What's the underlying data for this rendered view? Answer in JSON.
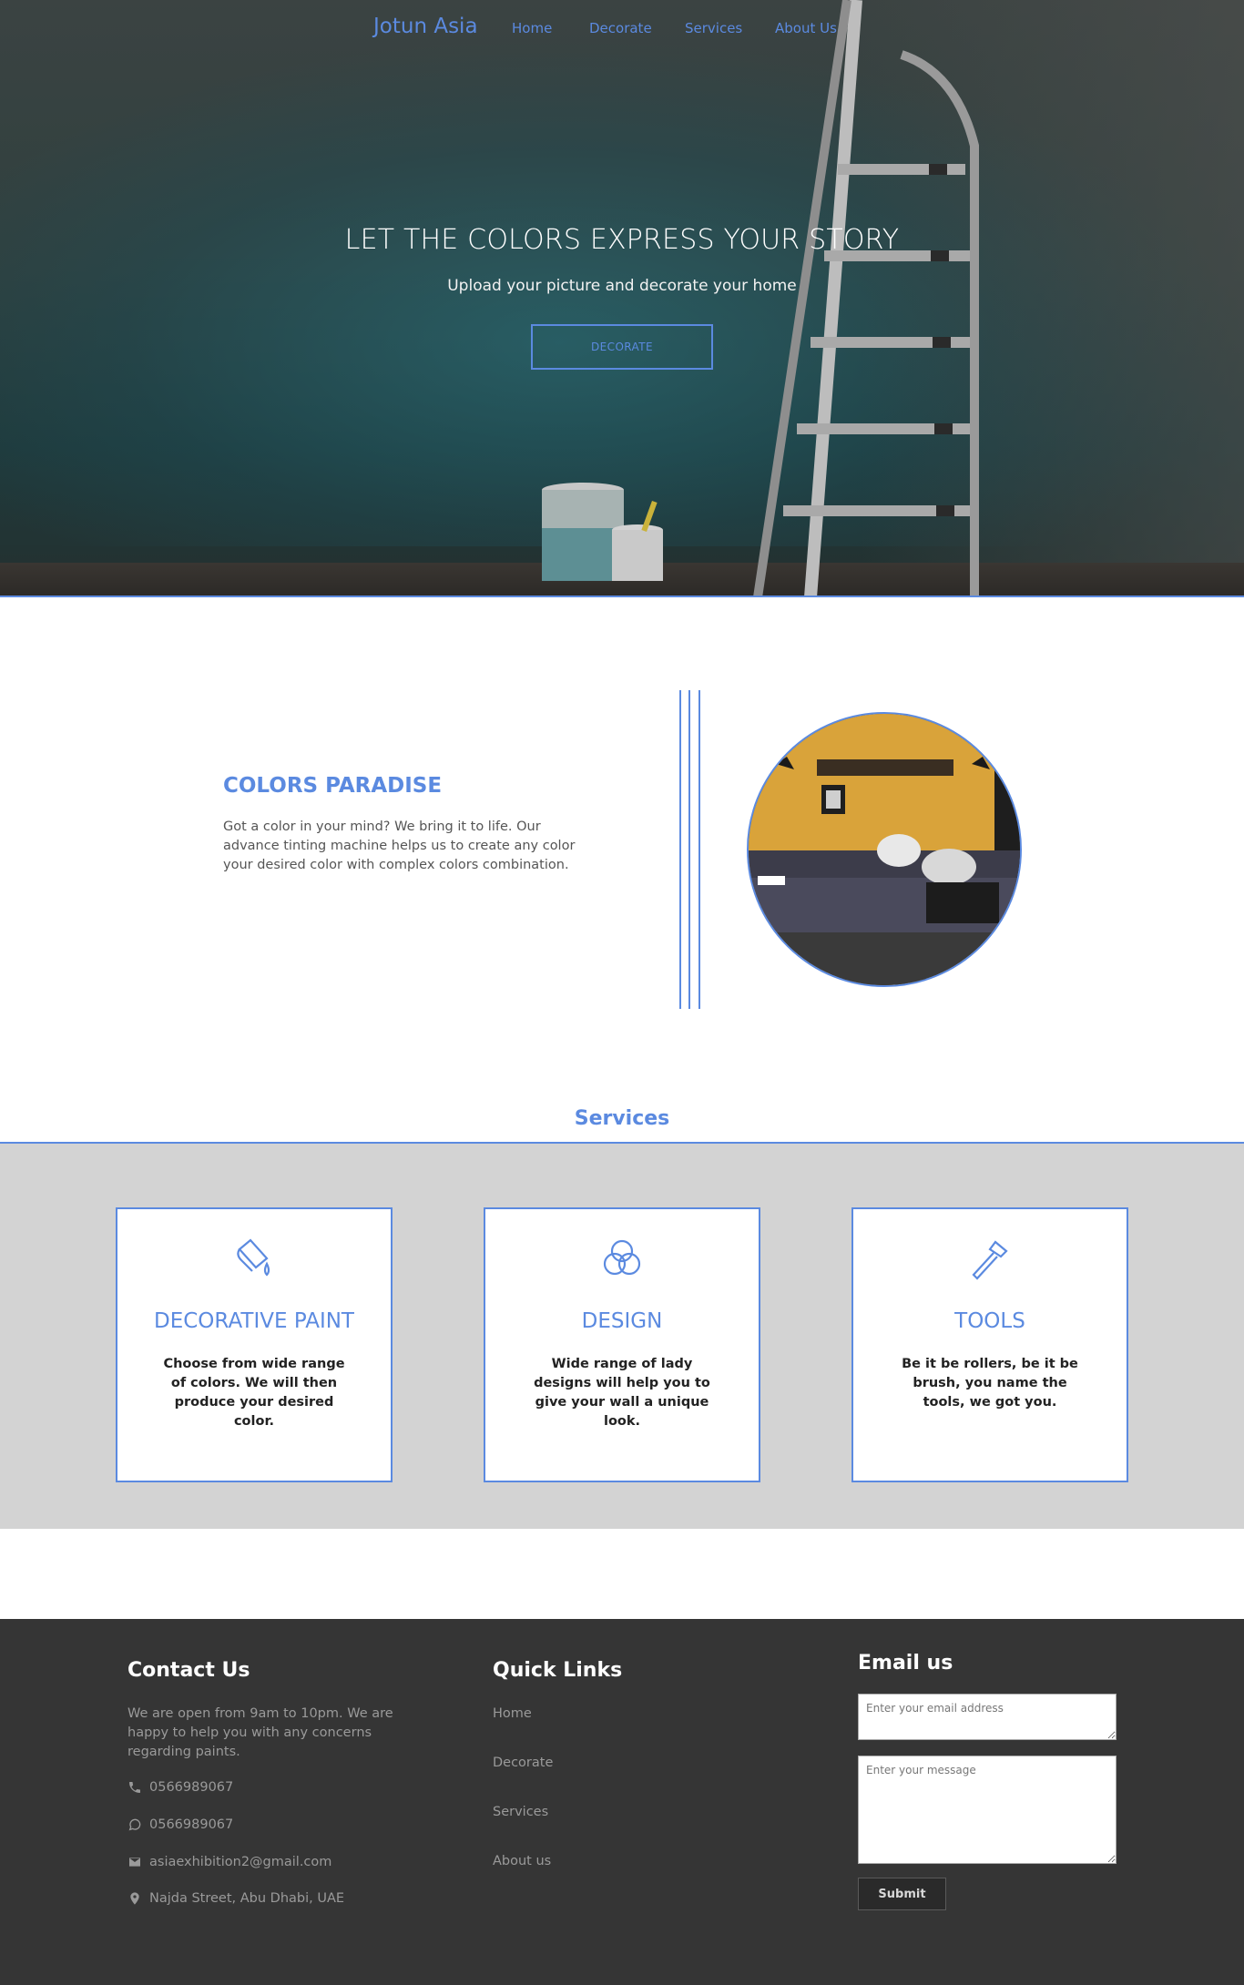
{
  "nav": {
    "brand": "Jotun Asia",
    "links": [
      "Home",
      "Decorate",
      "Services",
      "About Us"
    ]
  },
  "hero": {
    "title": "LET THE COLORS EXPRESS YOUR STORY",
    "subtitle": "Upload your picture and decorate your home",
    "button": "DECORATE"
  },
  "paradise": {
    "title": "COLORS PARADISE",
    "text": "Got a color in your mind? We bring it to life. Our advance tinting machine helps us to create any color your desired color with complex colors combination."
  },
  "services": {
    "title": "Services",
    "cards": [
      {
        "icon": "paint-bucket-icon",
        "title": "DECORATIVE PAINT",
        "text": "Choose from wide range of colors. We will then produce your desired color."
      },
      {
        "icon": "color-circles-icon",
        "title": "DESIGN",
        "text": "Wide range of lady designs will help you to give your wall a unique look."
      },
      {
        "icon": "hammer-icon",
        "title": "TOOLS",
        "text": "Be it be rollers, be it be brush, you name the tools, we got you."
      }
    ]
  },
  "footer": {
    "contact": {
      "title": "Contact Us",
      "text": "We are open from 9am to 10pm. We are happy to help you with any concerns regarding paints.",
      "phone": "0566989067",
      "whatsapp": "0566989067",
      "email": "asiaexhibition2@gmail.com",
      "address": "Najda Street, Abu Dhabi, UAE"
    },
    "quick_links": {
      "title": "Quick Links",
      "items": [
        "Home",
        "Decorate",
        "Services",
        "About us"
      ]
    },
    "email_us": {
      "title": "Email us",
      "email_placeholder": "Enter your email address",
      "message_placeholder": "Enter your message",
      "submit": "Submit"
    }
  },
  "colors": {
    "accent": "#5b8ae0",
    "footer_bg": "#353535",
    "services_bg": "#d3d3d3"
  }
}
